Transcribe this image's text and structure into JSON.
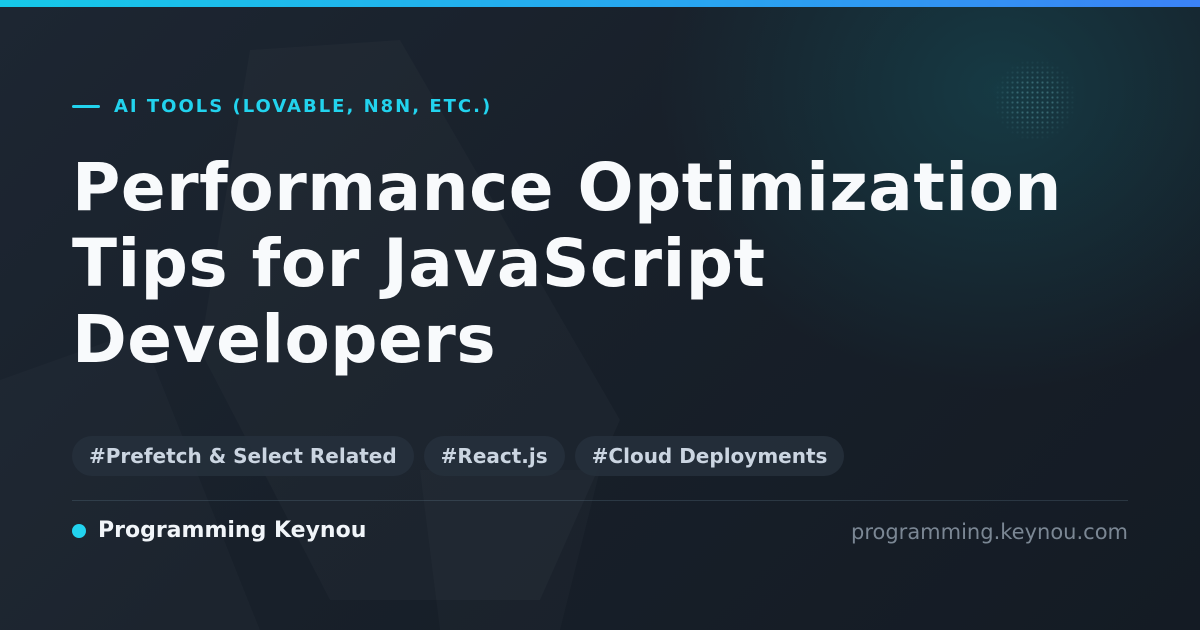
{
  "category": "AI TOOLS (LOVABLE, N8N, ETC.)",
  "title_lines": [
    "Performance Optimization",
    "Tips for JavaScript",
    "Developers"
  ],
  "tags": [
    "#Prefetch & Select Related",
    "#React.js",
    "#Cloud Deployments"
  ],
  "brand_name": "Programming Keynou",
  "site_url": "programming.keynou.com",
  "colors": {
    "accent": "#22d3ee",
    "background": "#161d26",
    "title": "#f8fafc",
    "tag_background": "#26303c",
    "tag_text": "#cbd5e1",
    "url_text": "#7b8794"
  }
}
